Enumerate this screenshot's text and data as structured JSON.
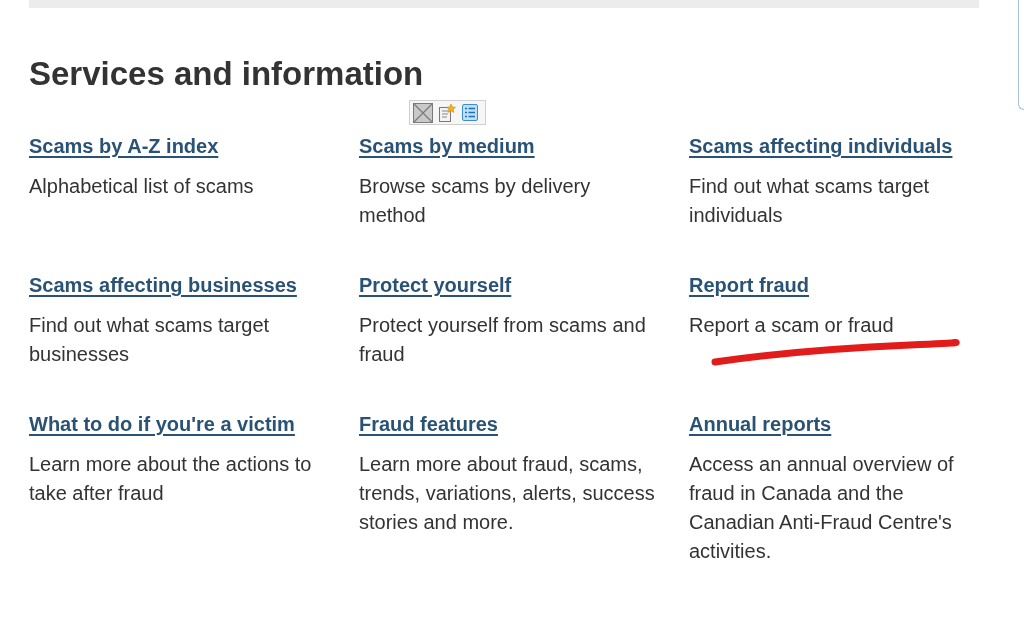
{
  "heading": "Services and information",
  "services": [
    {
      "title": "Scams by A-Z index",
      "description": "Alphabetical list of scams"
    },
    {
      "title": "Scams by medium",
      "description": "Browse scams by delivery method"
    },
    {
      "title": "Scams affecting individuals",
      "description": "Find out what scams target individuals"
    },
    {
      "title": "Scams affecting businesses",
      "description": "Find out what scams target businesses"
    },
    {
      "title": "Protect yourself",
      "description": "Protect yourself from scams and fraud"
    },
    {
      "title": "Report fraud",
      "description": "Report a scam or fraud"
    },
    {
      "title": "What to do if you're a victim",
      "description": "Learn more about the actions to take after fraud"
    },
    {
      "title": "Fraud features",
      "description": "Learn more about fraud, scams, trends, variations, alerts, success stories and more."
    },
    {
      "title": "Annual reports",
      "description": "Access an annual overview of fraud in Canada and the Canadian Anti-Fraud Centre's activities."
    }
  ]
}
